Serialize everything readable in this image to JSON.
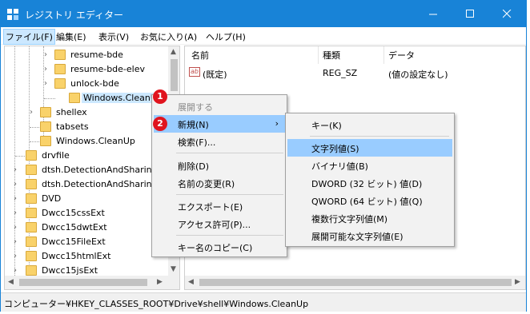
{
  "window": {
    "title": "レジストリ エディター"
  },
  "menubar": [
    {
      "label": "ファイル(F)"
    },
    {
      "label": "編集(E)"
    },
    {
      "label": "表示(V)"
    },
    {
      "label": "お気に入り(A)"
    },
    {
      "label": "ヘルプ(H)"
    }
  ],
  "tree": {
    "items": [
      {
        "label": "resume-bde"
      },
      {
        "label": "resume-bde-elev"
      },
      {
        "label": "unlock-bde"
      },
      {
        "label": "Windows.CleanUp"
      },
      {
        "label": "shellex"
      },
      {
        "label": "tabsets"
      },
      {
        "label": "Windows.CleanUp"
      },
      {
        "label": "drvfile"
      },
      {
        "label": "dtsh.DetectionAndSharing"
      },
      {
        "label": "dtsh.DetectionAndSharing"
      },
      {
        "label": "DVD"
      },
      {
        "label": "Dwcc15cssExt"
      },
      {
        "label": "Dwcc15dwtExt"
      },
      {
        "label": "Dwcc15FileExt"
      },
      {
        "label": "Dwcc15htmlExt"
      },
      {
        "label": "Dwcc15jsExt"
      }
    ]
  },
  "list": {
    "columns": [
      "名前",
      "種類",
      "データ"
    ],
    "rows": [
      {
        "name": "(既定)",
        "type": "REG_SZ",
        "data": "(値の設定なし)",
        "icon": "string-value-icon"
      }
    ]
  },
  "context_menu": {
    "items": [
      {
        "label": "展開する",
        "disabled": true
      },
      {
        "label": "新規(N)",
        "highlighted": true,
        "submenu": true
      },
      {
        "label": "検索(F)..."
      },
      {
        "label": "削除(D)"
      },
      {
        "label": "名前の変更(R)"
      },
      {
        "label": "エクスポート(E)"
      },
      {
        "label": "アクセス許可(P)..."
      },
      {
        "label": "キー名のコピー(C)"
      }
    ]
  },
  "submenu": {
    "items": [
      {
        "label": "キー(K)"
      },
      {
        "label": "文字列値(S)",
        "highlighted": true
      },
      {
        "label": "バイナリ値(B)"
      },
      {
        "label": "DWORD (32 ビット) 値(D)"
      },
      {
        "label": "QWORD (64 ビット) 値(Q)"
      },
      {
        "label": "複数行文字列値(M)"
      },
      {
        "label": "展開可能な文字列値(E)"
      }
    ]
  },
  "badges": [
    "1",
    "2"
  ],
  "statusbar": {
    "path": "コンピューター¥HKEY_CLASSES_ROOT¥Drive¥shell¥Windows.CleanUp"
  },
  "colors": {
    "titlebar": "#1883d7",
    "highlight": "#99ccff",
    "selection": "#cce8ff",
    "badge": "#e0141e",
    "folder": "#f9d26a"
  }
}
